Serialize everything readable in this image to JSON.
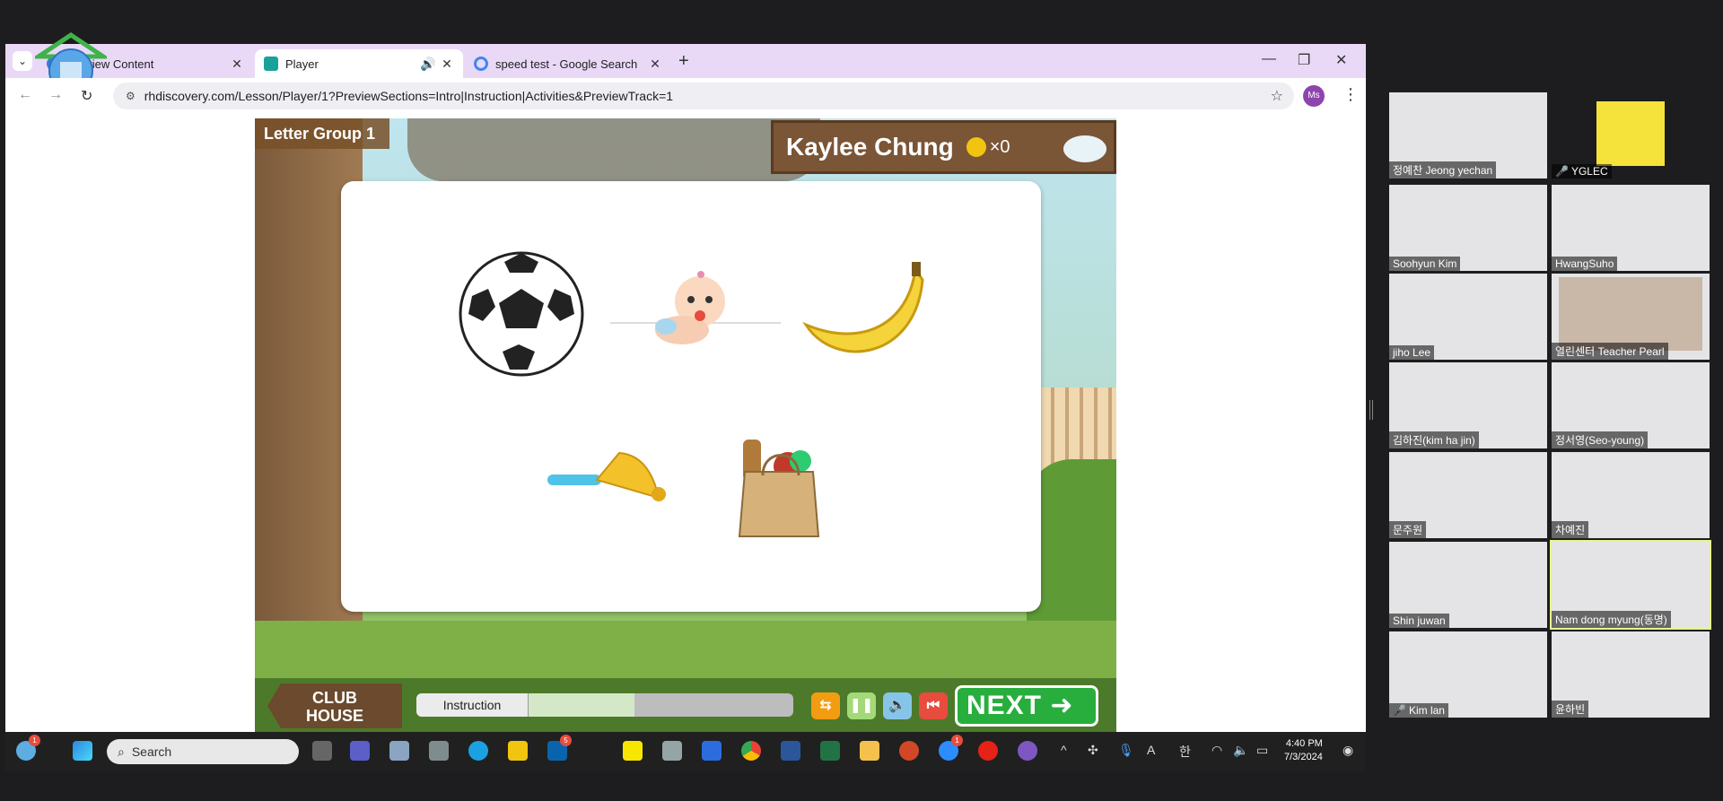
{
  "browser": {
    "tabs": [
      {
        "title": "Preview Content",
        "active": false
      },
      {
        "title": "Player",
        "active": true
      },
      {
        "title": "speed test - Google Search",
        "active": false
      }
    ],
    "url": "rhdiscovery.com/Lesson/Player/1?PreviewSections=Intro|Instruction|Activities&PreviewTrack=1",
    "profile_initials": "Ms"
  },
  "game": {
    "lesson_title": "Letter Group 1",
    "student_name": "Kaylee Chung",
    "coins": "×0",
    "pictures": [
      "soccer ball",
      "baby",
      "banana",
      "bell",
      "bag"
    ],
    "clubhouse_label": "CLUB\nHOUSE",
    "progress_label": "Instruction",
    "progress": 0.16,
    "next_label": "NEXT"
  },
  "taskbar": {
    "search_placeholder": "Search",
    "weather_badge": "1",
    "outlook_badge": "5",
    "zoom_badge": "1",
    "ime_label": "한",
    "font_label": "A",
    "time": "4:40 PM",
    "date": "7/3/2024"
  },
  "participants": [
    {
      "name": "정예찬 Jeong yechan",
      "muted": false
    },
    {
      "name": "YGLEC",
      "muted": true
    },
    {
      "name": "Soohyun Kim",
      "muted": false
    },
    {
      "name": "HwangSuho",
      "muted": false
    },
    {
      "name": "jiho Lee",
      "muted": false
    },
    {
      "name": "열린센터 Teacher Pearl",
      "muted": false
    },
    {
      "name": "김하진(kim ha jin)",
      "muted": false
    },
    {
      "name": "정서영(Seo-young)",
      "muted": false
    },
    {
      "name": "문주원",
      "muted": false
    },
    {
      "name": "차예진",
      "muted": false
    },
    {
      "name": "Shin juwan",
      "muted": false
    },
    {
      "name": "Nam dong myung(동명)",
      "muted": false
    },
    {
      "name": "Kim lan",
      "muted": true
    },
    {
      "name": "윤하빈",
      "muted": false
    }
  ],
  "colors": {
    "tabbar": "#e9d9f7",
    "next_button": "#27ae3d",
    "control_orange": "#f39c12",
    "control_green": "#a3d977",
    "control_blue": "#86c5e8",
    "control_red": "#e74c3c"
  }
}
